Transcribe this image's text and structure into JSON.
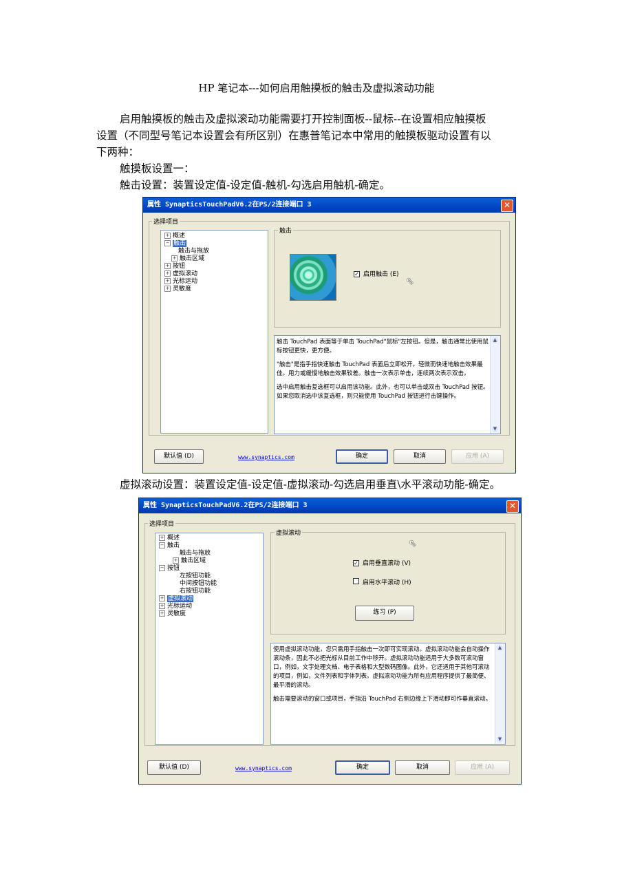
{
  "doc": {
    "title": "HP 笔记本---如何启用触摸板的触击及虚拟滚动功能",
    "intro_l1": "启用触摸板的触击及虚拟滚动功能需要打开控制面板--鼠标--在设置相应触摸板",
    "intro_l2": "设置（不同型号笔记本设置会有所区别）在惠普笔记本中常用的触摸板驱动设置有以",
    "intro_l3": "下两种：",
    "setting_one": "触摸板设置一：",
    "tap_setting": "触击设置：装置设定值-设定值-触机-勾选启用触机-确定。",
    "scroll_setting": "虚拟滚动设置：装置设定值-设定值-虚拟滚动-勾选启用垂直\\水平滚动功能-确定。"
  },
  "dialog1": {
    "title": "属性 SynapticsTouchPadV6.2在PS/2连接端口 3",
    "close": "✕",
    "group_label": "选择项目",
    "tree": [
      "概述",
      "触击",
      "触击与拖放",
      "触击区域",
      "按钮",
      "虚拟滚动",
      "光标运动",
      "灵敏度"
    ],
    "panel_title": "触击",
    "checkbox_label": "启用触击 (E)",
    "checkbox_mark": "✓",
    "desc": [
      "触击 TouchPad 表面等于单击 TouchPad\"鼠标\"左按钮。但是，触击通常比使用鼠标按钮更快，更方便。",
      "\"触击\"是指手指快速触击 TouchPad 表面后立即松开。轻微而快速地触击效果最佳。用力或缓慢地触击效果较差。触击一次表示单击，连续两次表示双击。",
      "选中启用触击复选框可以启用该功能。此外，也可以单击或双击 TouchPad 按钮。如果您取消选中该复选框，则只能使用 TouchPad 按钮进行击键操作。"
    ],
    "buttons": {
      "default": "默认值 (D)",
      "ok": "确定",
      "cancel": "取消",
      "apply": "应用 (A)"
    },
    "link": "www.synaptics.com"
  },
  "dialog2": {
    "title": "属性 SynapticsTouchPadV6.2在PS/2连接端口 3",
    "close": "✕",
    "group_label": "选择项目",
    "tree": [
      "概述",
      "触击",
      "触击与拖放",
      "触击区域",
      "按钮",
      "左按钮功能",
      "中间按钮功能",
      "右按钮功能",
      "虚拟滚动",
      "光标运动",
      "灵敏度"
    ],
    "panel_title": "虚拟滚动",
    "checkbox_vertical": "启用垂直滚动 (V)",
    "checkbox_horizontal": "启用水平滚动 (H)",
    "checkbox_mark": "✓",
    "practice": "练习 (P)",
    "desc": [
      "使用虚拟滚动功能，您只需用手指触击一次即可实现滚动。虚拟滚动功能会自动操作滚动条，因此不必把光标从目前工作中移开。虚拟滚动功能适用于大多数可滚动窗口，例如，文字处理文档、电子表格和大型数码图像。此外，它还适用于其他可滚动的项目，例如，文件列表和字体列表。虚拟滚动功能为所有应用程序提供了最简便、最平滑的滚动。",
      "触击需要滚动的窗口或项目，手指沿 TouchPad 右侧边缘上下滑动即可作垂直滚动。"
    ],
    "buttons": {
      "default": "默认值 (D)",
      "ok": "确定",
      "cancel": "取消",
      "apply": "应用 (A)"
    },
    "link": "www.synaptics.com"
  },
  "icons": {
    "scroll_up": "▲",
    "scroll_down": "▼",
    "cursor": "⇖",
    "expand": "+",
    "collapse": "−"
  }
}
